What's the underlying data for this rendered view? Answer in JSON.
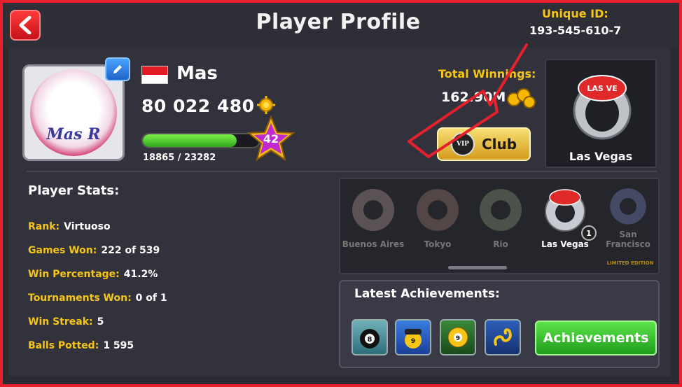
{
  "header": {
    "title": "Player Profile",
    "uid_label": "Unique ID:",
    "uid_value": "193-545-610-7"
  },
  "player": {
    "name": "Mas",
    "avatar_text": "Mas R",
    "coins": "80 022 480",
    "xp_text": "18865 / 23282",
    "xp_progress": 0.81,
    "level": "42",
    "flag": "indonesia"
  },
  "winnings": {
    "label": "Total Winnings:",
    "value": "162.90M"
  },
  "club": {
    "vip_label": "VIP",
    "label": "Club"
  },
  "featured_ring": {
    "name": "Las Vegas",
    "ring_badge": "LAS VE"
  },
  "stats": {
    "title": "Player Stats:",
    "rows": [
      {
        "label": "Rank:",
        "value": "Virtuoso"
      },
      {
        "label": "Games Won:",
        "value": "222 of 539"
      },
      {
        "label": "Win Percentage:",
        "value": "41.2%"
      },
      {
        "label": "Tournaments Won:",
        "value": "0 of 1"
      },
      {
        "label": "Win Streak:",
        "value": "5"
      },
      {
        "label": "Balls Potted:",
        "value": "1 595"
      }
    ]
  },
  "rings": {
    "items": [
      {
        "name": "Buenos Aires",
        "state": "locked"
      },
      {
        "name": "Tokyo",
        "state": "locked"
      },
      {
        "name": "Rio",
        "state": "locked"
      },
      {
        "name": "Las Vegas",
        "state": "owned"
      },
      {
        "name": "San Francisco",
        "state": "locked"
      }
    ],
    "las_vegas_count": "1",
    "limited_label": "LIMITED EDITION"
  },
  "achievements": {
    "title": "Latest Achievements:",
    "button_label": "Achievements",
    "badges": [
      "8",
      "9",
      "9"
    ]
  },
  "colors": {
    "accent_yellow": "#f5c518",
    "frame_red": "#e8202c",
    "green_button": "#2fa81a"
  }
}
